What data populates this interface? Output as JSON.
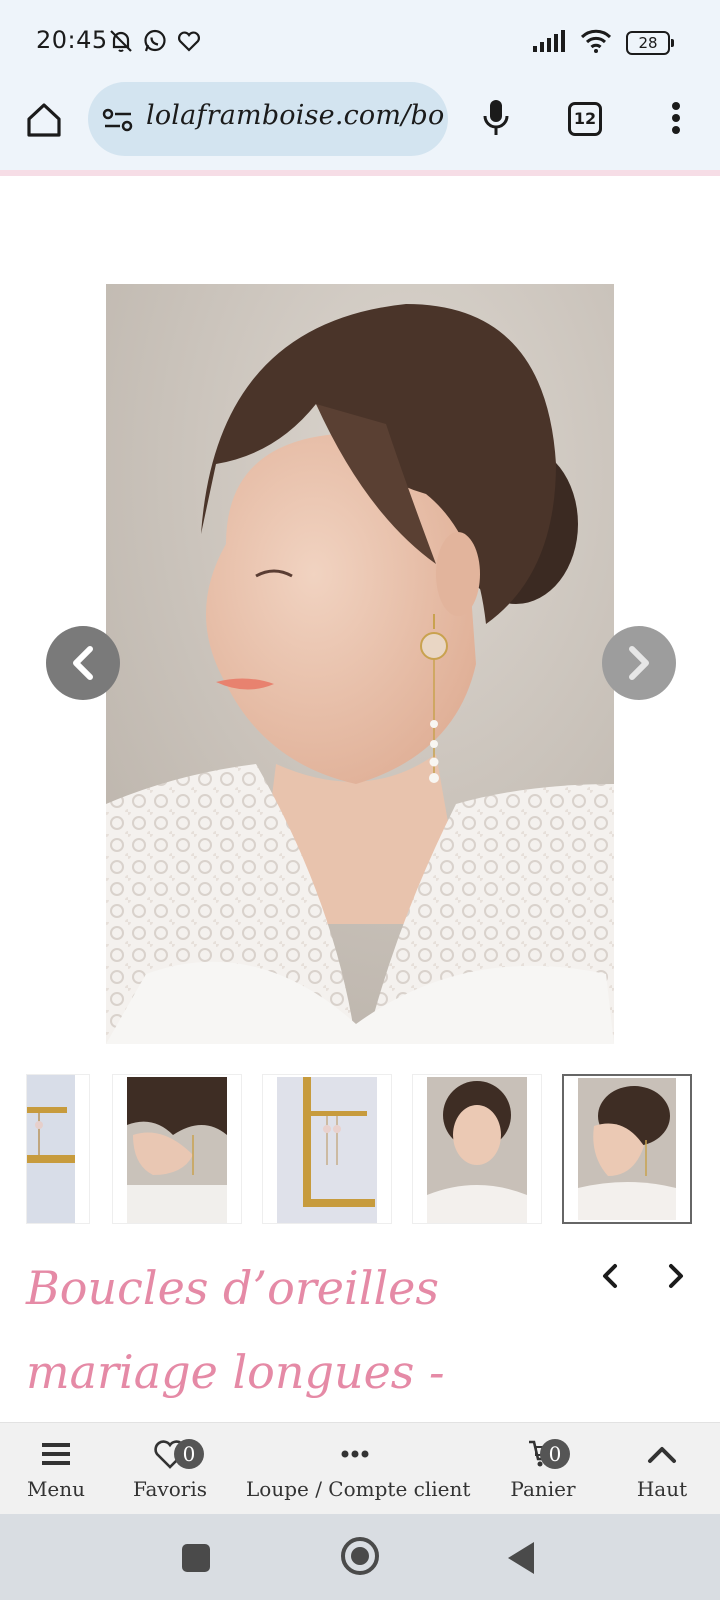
{
  "status_bar": {
    "time": "20:45",
    "battery": "28",
    "left_icons": [
      "notifications-off-icon",
      "whatsapp-icon",
      "heart-icon"
    ],
    "right_icons": [
      "signal-icon",
      "wifi-icon",
      "battery-icon"
    ]
  },
  "browser": {
    "url": "lolaframboise.com/bo",
    "tab_count": "12",
    "icons": [
      "home-icon",
      "site-settings-icon",
      "mic-icon",
      "tabs-icon",
      "more-vert-icon"
    ]
  },
  "gallery": {
    "main_image": "Woman with dark hair in a low bun wearing a long gold drop earring with pearls and a white lace top",
    "prev_icon": "chevron-left-icon",
    "next_icon": "chevron-right-icon",
    "thumbnails": [
      "earring on gold frame (cropped)",
      "earring close-up profile",
      "earrings hanging on gold frame",
      "woman smiling front view",
      "woman profile with earring"
    ],
    "selected_index": 4
  },
  "product": {
    "title_line1": "Boucles d’oreilles",
    "title_line2": "mariage longues -",
    "prev_icon": "chevron-left-icon",
    "next_icon": "chevron-right-icon"
  },
  "toolbar": {
    "menu_label": "Menu",
    "favoris_label": "Favoris",
    "favoris_count": "0",
    "loupe_label": "Loupe / Compte client",
    "panier_label": "Panier",
    "panier_count": "0",
    "haut_label": "Haut"
  },
  "colors": {
    "accent_pink": "#e58aa6",
    "chrome_bg": "#eef4fa",
    "url_pill": "#d3e4f0"
  }
}
